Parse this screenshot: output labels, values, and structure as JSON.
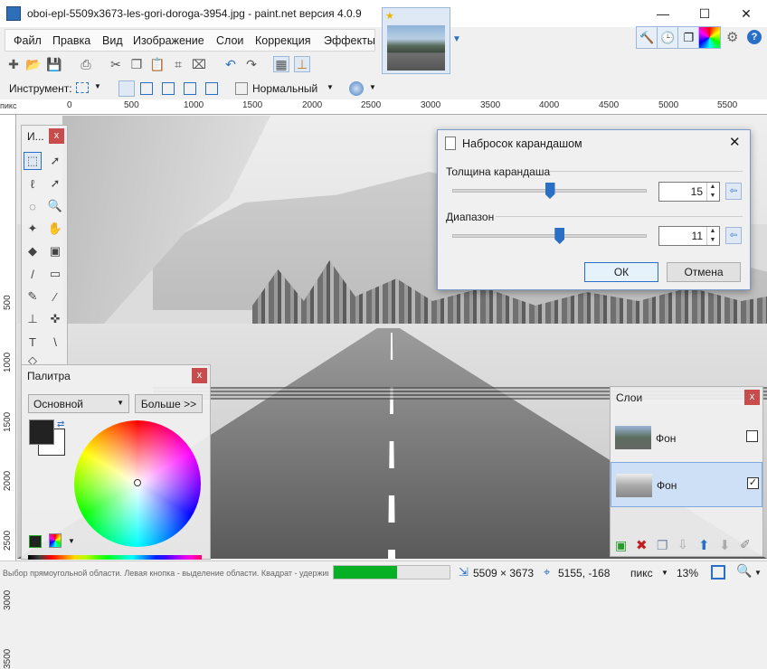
{
  "window": {
    "title": "oboi-epl-5509x3673-les-gori-doroga-3954.jpg - paint.net версия 4.0.9"
  },
  "menu": [
    "Файл",
    "Правка",
    "Вид",
    "Изображение",
    "Слои",
    "Коррекция",
    "Эффекты"
  ],
  "options": {
    "tool_label": "Инструмент:",
    "blend_mode": "Нормальный"
  },
  "ruler_top": [
    "0",
    "500",
    "1000",
    "1500",
    "2000",
    "2500",
    "3000",
    "3500",
    "4000",
    "4500",
    "5000",
    "5500"
  ],
  "ruler_left": [
    "500",
    "1000",
    "1500",
    "2000",
    "2500",
    "3000",
    "3500"
  ],
  "tools_panel": {
    "title": "И..."
  },
  "palette_panel": {
    "title": "Палитра",
    "mode": "Основной",
    "more_button": "Больше >>"
  },
  "dialog": {
    "title": "Набросок карандашом",
    "pencil_label": "Толщина карандаша",
    "pencil_value": "15",
    "pencil_fraction": 0.5,
    "range_label": "Диапазон",
    "range_value": "11",
    "range_fraction": 0.55,
    "ok": "ОК",
    "cancel": "Отмена"
  },
  "layers_panel": {
    "title": "Слои",
    "layers": [
      {
        "name": "Фон",
        "checked": false
      },
      {
        "name": "Фон",
        "checked": true
      }
    ]
  },
  "status": {
    "hint": "Выбор прямоугольной области. Левая кнопка - выделение области. Квадрат - удерживайте нажатой кла...",
    "progress": 0.55,
    "image_size": "5509 × 3673",
    "cursor": "5155, -168",
    "unit": "пикс",
    "zoom": "13%"
  },
  "colors": {
    "accent": "#2a6fc6",
    "progress": "#06b025",
    "close": "#c84c4c"
  }
}
